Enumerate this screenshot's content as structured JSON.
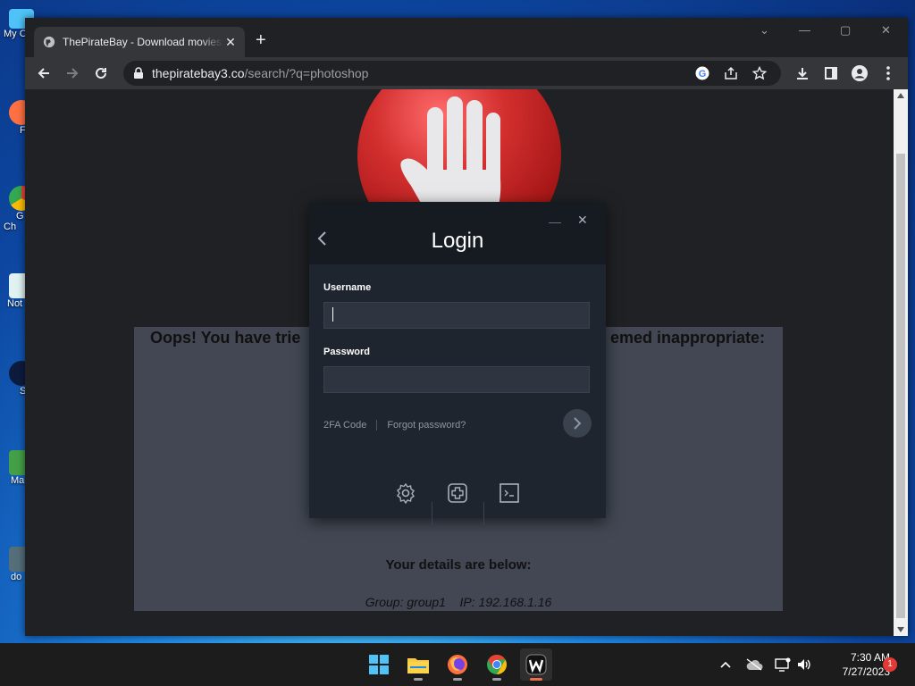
{
  "desktop": {
    "icons": [
      {
        "label": "My C",
        "name": "desktop-icon-my-computer"
      },
      {
        "label": "F",
        "name": "desktop-icon-firefox"
      },
      {
        "label": "G\nCh",
        "name": "desktop-icon-google-chrome"
      },
      {
        "label": "Not",
        "name": "desktop-icon-notepad"
      },
      {
        "label": "S",
        "name": "desktop-icon-s"
      },
      {
        "label": "Ma",
        "name": "desktop-icon-ma"
      },
      {
        "label": "do",
        "name": "desktop-icon-do"
      }
    ]
  },
  "browser": {
    "tab_title": "ThePirateBay - Download movies",
    "url_host": "thepiratebay3.co",
    "url_path": "/search/?q=photoshop"
  },
  "page": {
    "blocked_message_left": "Oops! You have trie",
    "blocked_message_right": "emed inappropriate:",
    "details_title": "Your details are below:",
    "details_group": "Group: group1",
    "details_ip": "IP: 192.168.1.16"
  },
  "login": {
    "title": "Login",
    "username_label": "Username",
    "username_value": "",
    "password_label": "Password",
    "password_value": "",
    "twofa_link": "2FA Code",
    "forgot_link": "Forgot password?"
  },
  "taskbar": {
    "time": "7:30 AM",
    "date": "7/27/2023",
    "notification_count": "1"
  },
  "colors": {
    "stop_sign": "#d32f2f",
    "login_bg": "#1f252e",
    "accent_indicator": "#ef6c4f"
  }
}
